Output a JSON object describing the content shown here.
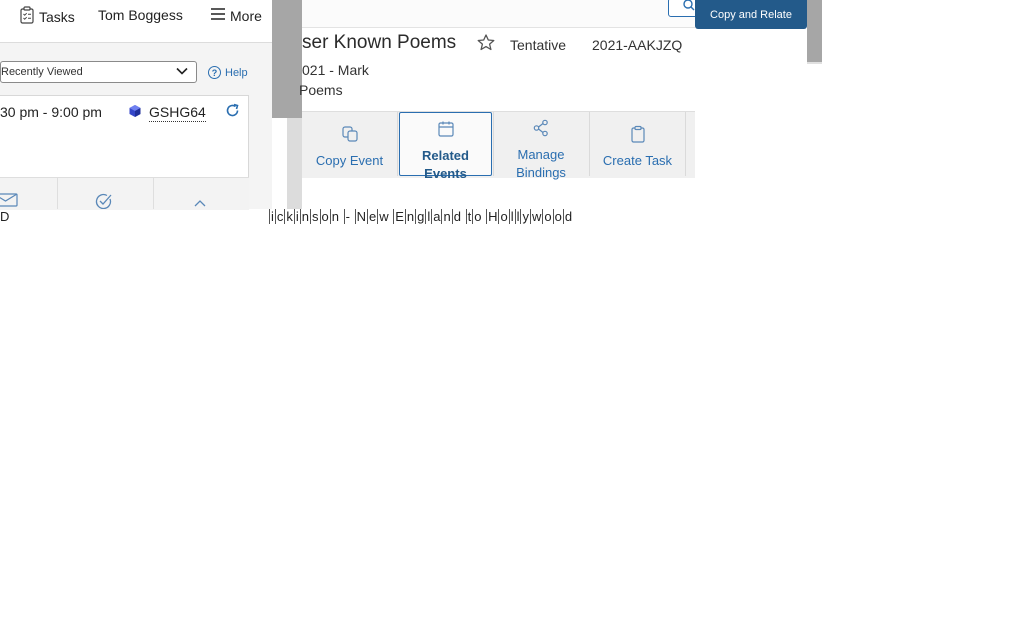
{
  "nav": {
    "tasks_label": "Tasks",
    "user_name": "Tom Boggess",
    "more_label": "More"
  },
  "filter": {
    "selected": "Recently Viewed",
    "help_label": "Help"
  },
  "event_card": {
    "time_range": "30 pm - 9:00 pm",
    "code": "GSHG64"
  },
  "header": {
    "copy_relate_label": "Copy and Relate",
    "title": "ser Known Poems",
    "state": "Tentative",
    "reference": "2021-AAKJZQ",
    "subline1": "021 - Mark",
    "subline2": "Poems"
  },
  "actions": [
    {
      "label_line1": "Copy Event",
      "label_line2": ""
    },
    {
      "label_line1": "Related",
      "label_line2": "Events"
    },
    {
      "label_line1": "Manage",
      "label_line2": "Bindings"
    },
    {
      "label_line1": "Create Task",
      "label_line2": ""
    }
  ],
  "bottom": {
    "left_text": "D",
    "title_text": "ickinson - New England to Hollywood"
  },
  "colors": {
    "accent": "#2a6eb0",
    "primary_button": "#235a8a",
    "scroll_gray": "#a6a6a6"
  },
  "icons": [
    "tasks-icon",
    "hamburger-icon",
    "chevron-down-icon",
    "help-icon",
    "cube-icon",
    "refresh-icon",
    "email-icon",
    "check-circle-icon",
    "chevron-up-icon",
    "search-icon",
    "star-icon",
    "copy-icon",
    "calendar-icon",
    "share-icon",
    "clipboard-icon"
  ]
}
